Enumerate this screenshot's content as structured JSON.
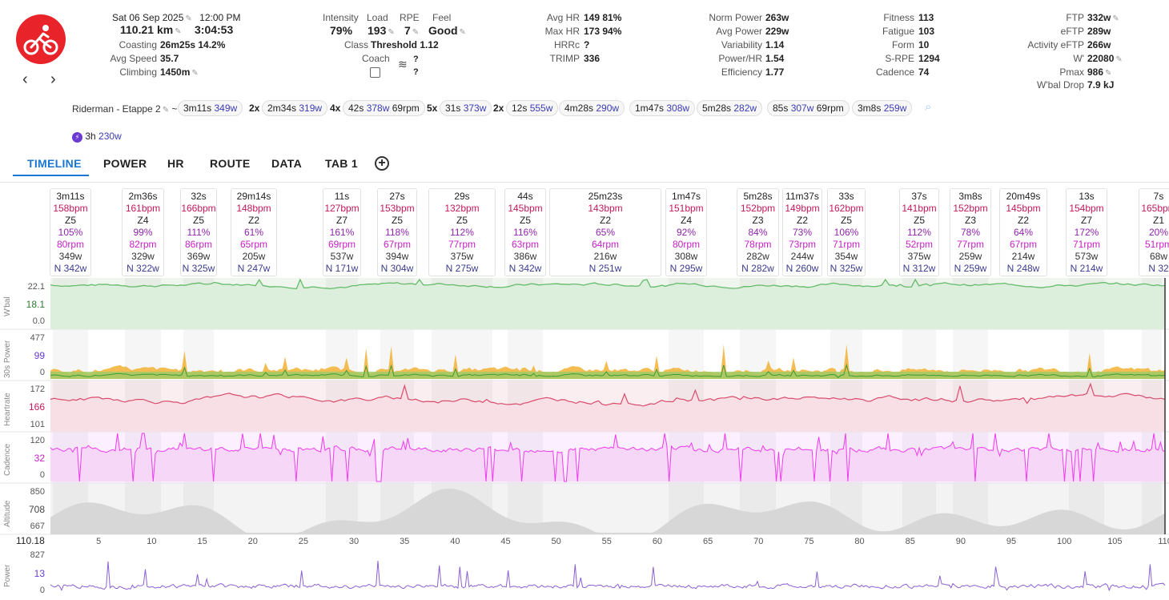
{
  "header": {
    "date_time": "Sat 06 Sep 2025",
    "time": "12:00 PM",
    "distance": "110.21 km",
    "duration": "3:04:53",
    "coasting_label": "Coasting",
    "coasting_value": "26m25s 14.2%",
    "avg_speed_label": "Avg Speed",
    "avg_speed_value": "35.7",
    "climbing_label": "Climbing",
    "climbing_value": "1450m"
  },
  "intensity": {
    "intensity_label": "Intensity",
    "intensity_value": "79%",
    "load_label": "Load",
    "load_value": "193",
    "rpe_label": "RPE",
    "rpe_value": "7",
    "feel_label": "Feel",
    "feel_value": "Good",
    "class_label": "Class",
    "class_value": "Threshold 1.12",
    "coach_label": "Coach",
    "wind_q1": "?",
    "wind_q2": "?"
  },
  "hr": {
    "avg_hr_label": "Avg HR",
    "avg_hr_value": "149 81%",
    "max_hr_label": "Max HR",
    "max_hr_value": "173 94%",
    "hrrc_label": "HRRc",
    "hrrc_value": "?",
    "trimp_label": "TRIMP",
    "trimp_value": "336"
  },
  "power": {
    "norm_label": "Norm Power",
    "norm_value": "263w",
    "avg_label": "Avg Power",
    "avg_value": "229w",
    "var_label": "Variability",
    "var_value": "1.14",
    "phr_label": "Power/HR",
    "phr_value": "1.54",
    "eff_label": "Efficiency",
    "eff_value": "1.77"
  },
  "fitness": {
    "fitness_label": "Fitness",
    "fitness_value": "113",
    "fatigue_label": "Fatigue",
    "fatigue_value": "103",
    "form_label": "Form",
    "form_value": "10",
    "srpe_label": "S-RPE",
    "srpe_value": "1294",
    "cad_label": "Cadence",
    "cad_value": "74"
  },
  "ftp": {
    "ftp_label": "FTP",
    "ftp_value": "332w",
    "eftp_label": "eFTP",
    "eftp_value": "289w",
    "aeftp_label": "Activity eFTP",
    "aeftp_value": "266w",
    "wp_label": "W'",
    "wp_value": "22080",
    "pmax_label": "Pmax",
    "pmax_value": "986",
    "wbal_label": "W'bal Drop",
    "wbal_value": "7.9 kJ"
  },
  "intervals_bar": {
    "title": "Riderman - Etappe 2",
    "tilde": "~",
    "chips": [
      {
        "count": "",
        "dur": "3m11s",
        "pw": "349w",
        "extra": ""
      },
      {
        "count": "2x",
        "dur": "2m34s",
        "pw": "319w",
        "extra": ""
      },
      {
        "count": "4x",
        "dur": "42s",
        "pw": "378w",
        "extra": " 69rpm"
      },
      {
        "count": "5x",
        "dur": "31s",
        "pw": "373w",
        "extra": ""
      },
      {
        "count": "2x",
        "dur": "12s",
        "pw": "555w",
        "extra": ""
      },
      {
        "count": "",
        "dur": "4m28s",
        "pw": "290w",
        "extra": ""
      },
      {
        "count": "",
        "dur": "1m47s",
        "pw": "308w",
        "extra": ""
      },
      {
        "count": "",
        "dur": "5m28s",
        "pw": "282w",
        "extra": ""
      },
      {
        "count": "",
        "dur": "85s",
        "pw": "307w",
        "extra": " 69rpm"
      },
      {
        "count": "",
        "dur": "3m8s",
        "pw": "259w",
        "extra": ""
      }
    ],
    "bolt_dur": "3h",
    "bolt_pw": "230w"
  },
  "tabs": [
    "TIMELINE",
    "POWER",
    "HR",
    "ROUTE",
    "DATA",
    "TAB 1"
  ],
  "cards": [
    {
      "dur": "3m11s",
      "hr": "158bpm",
      "zone": "Z5",
      "pct": "105%",
      "rpm": "80rpm",
      "w": "349w",
      "np": "N 342w"
    },
    {
      "dur": "2m36s",
      "hr": "161bpm",
      "zone": "Z4",
      "pct": "99%",
      "rpm": "82rpm",
      "w": "329w",
      "np": "N 322w"
    },
    {
      "dur": "32s",
      "hr": "166bpm",
      "zone": "Z5",
      "pct": "111%",
      "rpm": "86rpm",
      "w": "369w",
      "np": "N 325w"
    },
    {
      "dur": "29m14s",
      "hr": "148bpm",
      "zone": "Z2",
      "pct": "61%",
      "rpm": "65rpm",
      "w": "205w",
      "np": "N 247w"
    },
    {
      "dur": "11s",
      "hr": "127bpm",
      "zone": "Z7",
      "pct": "161%",
      "rpm": "69rpm",
      "w": "537w",
      "np": "N 171w"
    },
    {
      "dur": "27s",
      "hr": "153bpm",
      "zone": "Z5",
      "pct": "118%",
      "rpm": "67rpm",
      "w": "394w",
      "np": "N 304w"
    },
    {
      "dur": "29s",
      "hr": "132bpm",
      "zone": "Z5",
      "pct": "112%",
      "rpm": "77rpm",
      "w": "375w",
      "np": "N 275w"
    },
    {
      "dur": "44s",
      "hr": "145bpm",
      "zone": "Z5",
      "pct": "116%",
      "rpm": "63rpm",
      "w": "386w",
      "np": "N 342w"
    },
    {
      "dur": "25m23s",
      "hr": "143bpm",
      "zone": "Z2",
      "pct": "65%",
      "rpm": "64rpm",
      "w": "216w",
      "np": "N 251w"
    },
    {
      "dur": "1m47s",
      "hr": "151bpm",
      "zone": "Z4",
      "pct": "92%",
      "rpm": "80rpm",
      "w": "308w",
      "np": "N 295w"
    },
    {
      "dur": "5m28s",
      "hr": "152bpm",
      "zone": "Z3",
      "pct": "84%",
      "rpm": "78rpm",
      "w": "282w",
      "np": "N 282w"
    },
    {
      "dur": "11m37s",
      "hr": "149bpm",
      "zone": "Z2",
      "pct": "73%",
      "rpm": "73rpm",
      "w": "244w",
      "np": "N 260w"
    },
    {
      "dur": "33s",
      "hr": "162bpm",
      "zone": "Z5",
      "pct": "106%",
      "rpm": "71rpm",
      "w": "354w",
      "np": "N 325w"
    },
    {
      "dur": "37s",
      "hr": "141bpm",
      "zone": "Z5",
      "pct": "112%",
      "rpm": "52rpm",
      "w": "375w",
      "np": "N 312w"
    },
    {
      "dur": "3m8s",
      "hr": "152bpm",
      "zone": "Z3",
      "pct": "78%",
      "rpm": "77rpm",
      "w": "259w",
      "np": "N 259w"
    },
    {
      "dur": "20m49s",
      "hr": "145bpm",
      "zone": "Z2",
      "pct": "64%",
      "rpm": "67rpm",
      "w": "214w",
      "np": "N 248w"
    },
    {
      "dur": "13s",
      "hr": "154bpm",
      "zone": "Z7",
      "pct": "172%",
      "rpm": "71rpm",
      "w": "573w",
      "np": "N 214w"
    },
    {
      "dur": "7s",
      "hr": "165bpm",
      "zone": "Z1",
      "pct": "20%",
      "rpm": "51rpm",
      "w": "68w",
      "np": "N 32"
    }
  ],
  "panels": {
    "wbal": {
      "label": "W'bal",
      "top": "22.1",
      "mid": "18.1",
      "bottom": "0.0"
    },
    "power30": {
      "label": "30s Power",
      "top": "477",
      "mid": "99",
      "bottom": "0"
    },
    "heartrate": {
      "label": "Heartrate",
      "top": "172",
      "mid": "166",
      "bottom": "101"
    },
    "cadence": {
      "label": "Cadence",
      "top": "120",
      "mid": "32",
      "bottom": "0"
    },
    "altitude": {
      "label": "Altitude",
      "top": "850",
      "mid": "708",
      "bottom": "667"
    },
    "power": {
      "label": "Power",
      "top": "827",
      "mid": "13",
      "bottom": "0"
    }
  },
  "xaxis": {
    "cursor": "110.18",
    "ticks": [
      "5",
      "10",
      "15",
      "20",
      "25",
      "30",
      "35",
      "40",
      "45",
      "50",
      "55",
      "60",
      "65",
      "70",
      "75",
      "80",
      "85",
      "90",
      "95",
      "100",
      "105",
      "110"
    ]
  },
  "colors": {
    "logo": "#e8232a",
    "accent": "#1976d2",
    "wbal_line": "#66bb6a",
    "hr_line": "#d84b6b",
    "cadence_line": "#ee3bee",
    "altitude_fill": "#d7d7d7",
    "power_line": "#8a5fd3"
  }
}
